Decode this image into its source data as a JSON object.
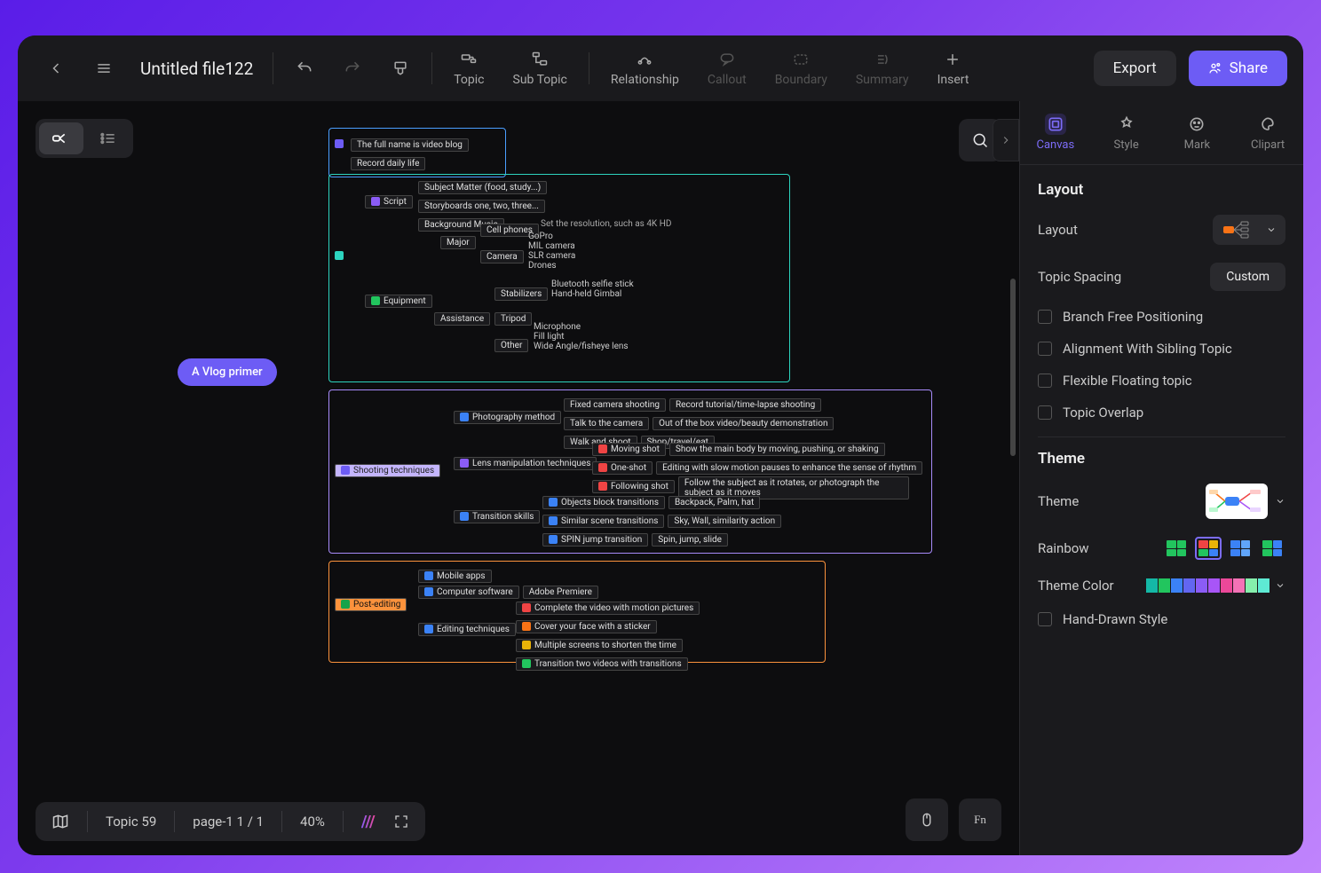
{
  "toolbar": {
    "title": "Untitled file122",
    "topic": "Topic",
    "subtopic": "Sub Topic",
    "relationship": "Relationship",
    "callout": "Callout",
    "boundary": "Boundary",
    "summary": "Summary",
    "insert": "Insert",
    "export": "Export",
    "share": "Share"
  },
  "panel": {
    "tabs": {
      "canvas": "Canvas",
      "style": "Style",
      "mark": "Mark",
      "clipart": "Clipart"
    },
    "layout_title": "Layout",
    "layout_label": "Layout",
    "spacing_label": "Topic Spacing",
    "spacing_btn": "Custom",
    "checks": [
      "Branch Free Positioning",
      "Alignment With Sibling Topic",
      "Flexible Floating topic",
      "Topic Overlap"
    ],
    "theme_title": "Theme",
    "theme_label": "Theme",
    "rainbow_label": "Rainbow",
    "themecolor_label": "Theme Color",
    "handdrawn": "Hand-Drawn Style"
  },
  "bottom": {
    "topic": "Topic 59",
    "page": "page-1  1 / 1",
    "zoom": "40%"
  },
  "mindmap": {
    "root": "A Vlog primer",
    "g1": [
      "The full name is video blog",
      "Record daily life"
    ],
    "g2": {
      "script": {
        "label": "Script",
        "items": [
          "Subject Matter (food, study...)",
          "Storyboards one, two, three...",
          "Background Music"
        ]
      },
      "equipment": {
        "label": "Equipment",
        "major": {
          "label": "Major",
          "cellphones": "Cell phones",
          "cellnote": "Set the resolution, such as 4K HD",
          "camera": "Camera",
          "camitems": [
            "GoPro",
            "MIL camera",
            "SLR camera",
            "Drones"
          ]
        },
        "assist": {
          "label": "Assistance",
          "stab": "Stabilizers",
          "stabitems": [
            "Bluetooth selfie stick",
            "Hand-held Gimbal"
          ],
          "tripod": "Tripod",
          "other": "Other",
          "otheritems": [
            "Microphone",
            "Fill light",
            "Wide Angle/fisheye lens"
          ]
        }
      }
    },
    "g3": {
      "label": "Shooting techniques",
      "photo": {
        "label": "Photography method",
        "rows": [
          [
            "Fixed camera shooting",
            "Record tutorial/time-lapse shooting"
          ],
          [
            "Talk to the camera",
            "Out of the box video/beauty demonstration"
          ],
          [
            "Walk and shoot",
            "Shop/travel/eat"
          ]
        ]
      },
      "lens": {
        "label": "Lens manipulation techniques",
        "rows": [
          [
            "Moving shot",
            "Show the main body by moving, pushing, or shaking"
          ],
          [
            "One-shot",
            "Editing with slow motion pauses to enhance the sense of rhythm"
          ],
          [
            "Following shot",
            "Follow the subject as it rotates, or photograph the subject as it moves"
          ]
        ]
      },
      "trans": {
        "label": "Transition skills",
        "rows": [
          [
            "Objects block transitions",
            "Backpack, Palm, hat"
          ],
          [
            "Similar scene transitions",
            "Sky, Wall, similarity action"
          ],
          [
            "SPIN jump transition",
            "Spin, jump, slide"
          ]
        ]
      }
    },
    "g4": {
      "label": "Post-editing",
      "apps": "Mobile apps",
      "sw": "Computer software",
      "swnote": "Adobe Premiere",
      "tech": {
        "label": "Editing techniques",
        "items": [
          "Complete the video with motion pictures",
          "Cover your face with a sticker",
          "Multiple screens to shorten the time",
          "Transition two videos with transitions"
        ]
      }
    }
  }
}
